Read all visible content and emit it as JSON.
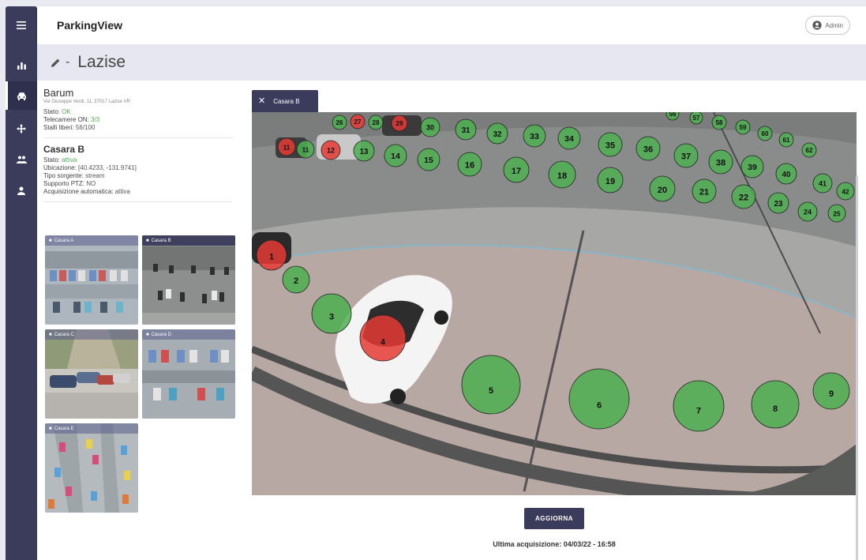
{
  "app": {
    "title": "ParkingView",
    "user_label": "Admin"
  },
  "nav": [
    {
      "icon": "menu-icon"
    },
    {
      "icon": "bar-chart-icon"
    },
    {
      "icon": "car-icon",
      "active": true
    },
    {
      "icon": "move-arrows-icon"
    },
    {
      "icon": "people-icon"
    },
    {
      "icon": "person-icon"
    }
  ],
  "page": {
    "separator": "-",
    "title": "Lazise",
    "edit_icon": "pencil-icon"
  },
  "site": {
    "name": "Barum",
    "address": "Via Giuseppe Verdi, 11, 37017 Lazise VR",
    "status_label": "Stato:",
    "status_value": "OK",
    "cameras_label": "Telecamere ON:",
    "cameras_value": "3/3",
    "stalls_label": "Stalli liberi:",
    "stalls_value": "56/100"
  },
  "camera": {
    "name": "Casara B",
    "status_label": "Stato:",
    "status_value": "attiva",
    "location_label": "Ubicazione:",
    "location_value": "[40.4233, -131.9741]",
    "source_label": "Tipo sorgente:",
    "source_value": "stream",
    "ptz_label": "Supporto PTZ:",
    "ptz_value": "NO",
    "auto_label": "Acquisizione automatica:",
    "auto_value": "attiva"
  },
  "thumbnails": [
    {
      "label": "Casara A",
      "selected": false
    },
    {
      "label": "Casara B",
      "selected": true
    },
    {
      "label": "Casara C",
      "selected": false
    },
    {
      "label": "Casara D",
      "selected": false
    },
    {
      "label": "Casara E",
      "selected": false
    }
  ],
  "viewer": {
    "tab_label": "Casara B",
    "refresh_label": "AGGIORNA",
    "last_acquisition": "Ultima acquisizione: 04/03/22 - 16:58"
  },
  "colors": {
    "occupied": "#e53935",
    "free": "#4caf50",
    "accent": "#3b3b5c"
  },
  "stalls": [
    {
      "label": "1",
      "occupied": true
    },
    {
      "label": "2",
      "occupied": false
    },
    {
      "label": "3",
      "occupied": false
    },
    {
      "label": "4",
      "occupied": true
    },
    {
      "label": "5",
      "occupied": false
    },
    {
      "label": "6",
      "occupied": false
    },
    {
      "label": "7",
      "occupied": false
    },
    {
      "label": "8",
      "occupied": false
    },
    {
      "label": "9",
      "occupied": false
    },
    {
      "label": "11",
      "occupied": true
    },
    {
      "label": "11",
      "occupied": false
    },
    {
      "label": "12",
      "occupied": true
    },
    {
      "label": "13",
      "occupied": false
    },
    {
      "label": "14",
      "occupied": false
    },
    {
      "label": "15",
      "occupied": false
    },
    {
      "label": "16",
      "occupied": false
    },
    {
      "label": "17",
      "occupied": false
    },
    {
      "label": "18",
      "occupied": false
    },
    {
      "label": "19",
      "occupied": false
    },
    {
      "label": "20",
      "occupied": false
    },
    {
      "label": "21",
      "occupied": false
    },
    {
      "label": "22",
      "occupied": false
    },
    {
      "label": "23",
      "occupied": false
    },
    {
      "label": "24",
      "occupied": false
    },
    {
      "label": "25",
      "occupied": false
    },
    {
      "label": "26",
      "occupied": false
    },
    {
      "label": "27",
      "occupied": true
    },
    {
      "label": "28",
      "occupied": false
    },
    {
      "label": "29",
      "occupied": true
    },
    {
      "label": "30",
      "occupied": false
    },
    {
      "label": "31",
      "occupied": false
    },
    {
      "label": "32",
      "occupied": false
    },
    {
      "label": "33",
      "occupied": false
    },
    {
      "label": "34",
      "occupied": false
    },
    {
      "label": "35",
      "occupied": false
    },
    {
      "label": "36",
      "occupied": false
    },
    {
      "label": "37",
      "occupied": false
    },
    {
      "label": "38",
      "occupied": false
    },
    {
      "label": "39",
      "occupied": false
    },
    {
      "label": "40",
      "occupied": false
    },
    {
      "label": "41",
      "occupied": false
    },
    {
      "label": "42",
      "occupied": false
    },
    {
      "label": "56",
      "occupied": false
    },
    {
      "label": "57",
      "occupied": false
    },
    {
      "label": "58",
      "occupied": false
    },
    {
      "label": "59",
      "occupied": false
    },
    {
      "label": "60",
      "occupied": false
    },
    {
      "label": "61",
      "occupied": false
    },
    {
      "label": "62",
      "occupied": false
    }
  ]
}
